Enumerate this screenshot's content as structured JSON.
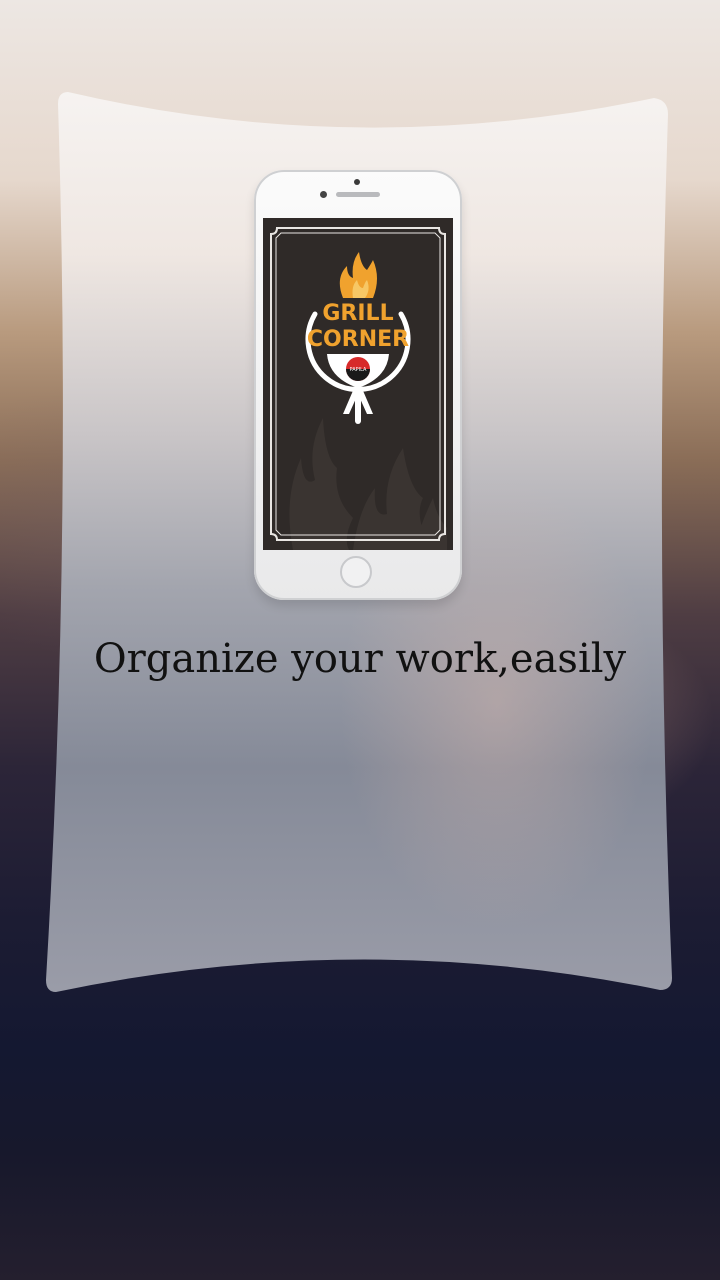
{
  "tagline": "Organize your work,easily",
  "app_logo": {
    "line1": "GRILL",
    "line2": "CORNER",
    "badge_text": "PAPILA\nBITES"
  },
  "colors": {
    "logo_orange": "#f0a22e",
    "screen_bg": "#2f2a28",
    "card": "#f3f0ee"
  },
  "icons": [
    "flame-icon",
    "grill-icon"
  ]
}
